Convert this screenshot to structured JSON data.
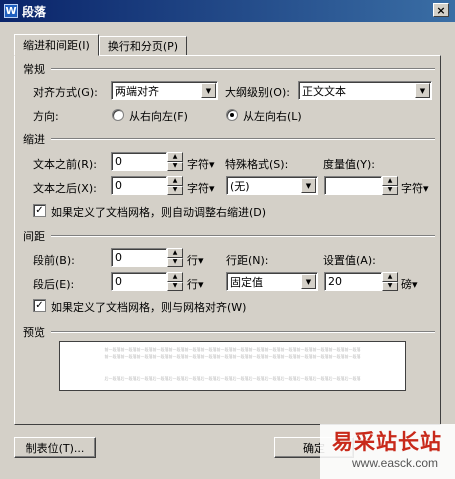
{
  "window": {
    "title": "段落",
    "app_icon": "W",
    "close_glyph": "×"
  },
  "tabs": [
    {
      "label": "缩进和间距(I)",
      "active": true
    },
    {
      "label": "换行和分页(P)",
      "active": false
    }
  ],
  "general": {
    "heading": "常规",
    "alignment_label": "对齐方式(G):",
    "alignment_value": "两端对齐",
    "outline_label": "大纲级别(O):",
    "outline_value": "正文文本",
    "direction_label": "方向:",
    "rtl_label": "从右向左(F)",
    "ltr_label": "从左向右(L)"
  },
  "indent": {
    "heading": "缩进",
    "before_label": "文本之前(R):",
    "before_value": "0",
    "before_unit": "字符▾",
    "after_label": "文本之后(X):",
    "after_value": "0",
    "after_unit": "字符▾",
    "special_label": "特殊格式(S):",
    "special_value": "(无)",
    "measure_label": "度量值(Y):",
    "measure_value": "",
    "measure_unit": "字符▾",
    "grid_checkbox_label": "如果定义了文档网格，则自动调整右缩进(D)",
    "grid_checked": true
  },
  "spacing": {
    "heading": "间距",
    "before_label": "段前(B):",
    "before_value": "0",
    "before_unit": "行▾",
    "after_label": "段后(E):",
    "after_value": "0",
    "after_unit": "行▾",
    "line_label": "行距(N):",
    "line_value": "固定值",
    "setting_label": "设置值(A):",
    "setting_value": "20",
    "setting_unit": "磅▾",
    "grid_checkbox_label": "如果定义了文档网格，则与网格对齐(W)",
    "grid_checked": true
  },
  "preview": {
    "heading": "预览",
    "prev_text": "前一段落前一段落前一段落前一段落前一段落前一段落前一段落前一段落前一段落前一段落前一段落前一段落前一段落前一段落前一段落前一段落",
    "next_text": "后一段落后一段落后一段落后一段落后一段落后一段落后一段落后一段落后一段落后一段落后一段落后一段落后一段落后一段落后一段落后一段落"
  },
  "buttons": {
    "tabs_label": "制表位(T)...",
    "ok_label": "确定"
  },
  "watermark": {
    "text_cn": "易采站长站",
    "text_en": "www.easck.com"
  },
  "icons": {
    "check": "✓",
    "down": "▼",
    "up": "▲"
  }
}
